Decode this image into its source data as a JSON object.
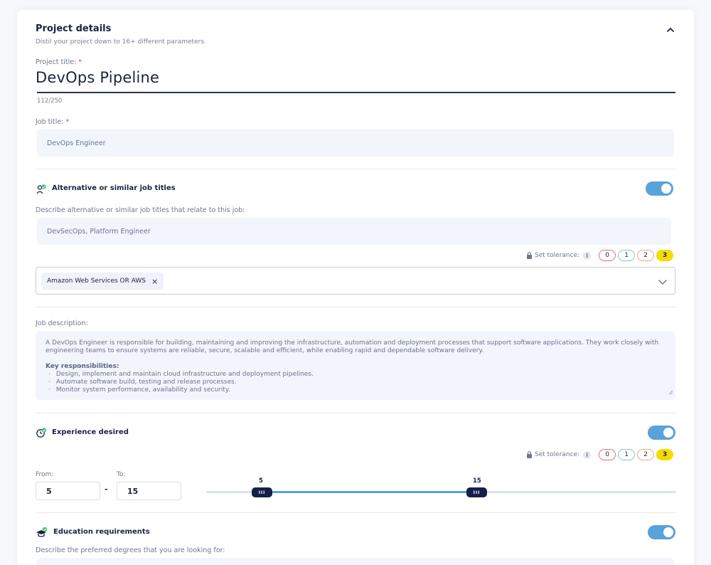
{
  "header": {
    "title": "Project details",
    "subtitle": "Distil your project down to 16+ different parameters."
  },
  "project_title": {
    "label": "Project title:",
    "required": "*",
    "value": "DevOps Pipeline",
    "counter": "112/250"
  },
  "job_title": {
    "label": "Job title:",
    "required": "*",
    "value": "DevOps Engineer"
  },
  "alt_titles": {
    "title": "Alternative or similar job titles",
    "enabled": true,
    "prompt": "Describe alternative or similar job titles that relate to this job:",
    "value": "DevSecOps, Platform Engineer",
    "tolerance_label": "Set tolerance:",
    "tolerance_options": [
      "0",
      "1",
      "2",
      "3"
    ],
    "tolerance_selected": "3",
    "chip": "Amazon Web Services OR AWS",
    "chip_remove": "×"
  },
  "job_description": {
    "label": "Job description:",
    "paragraph": "A DevOps Engineer is responsible for building, maintaining and improving the infrastructure, automation and deployment processes that support software applications. They work closely with engineering teams to ensure systems are reliable, secure, scalable and efficient, while enabling rapid and dependable software delivery.",
    "responsibilities_heading": "Key responsibilities:",
    "responsibilities": [
      "Design, implement and maintain cloud infrastructure and deployment pipelines.",
      "Automate software build, testing and release processes.",
      "Monitor system performance, availability and security."
    ]
  },
  "experience": {
    "title": "Experience desired",
    "enabled": true,
    "tolerance_label": "Set tolerance:",
    "tolerance_options": [
      "0",
      "1",
      "2",
      "3"
    ],
    "tolerance_selected": "3",
    "from_label": "From:",
    "to_label": "To:",
    "from_value": "5",
    "to_value": "15",
    "separator": "-",
    "slider_min": 0,
    "slider_max": 40
  },
  "education": {
    "title": "Education requirements",
    "enabled": true,
    "prompt": "Describe the preferred degrees that you are looking for:"
  },
  "colors": {
    "accent": "#5aa2da",
    "navy": "#15204a",
    "tol0": "#e36b7f",
    "tol1": "#7fc7c2",
    "tol2": "#efa77a",
    "tol3": "#f5dc00"
  },
  "info_glyph": "i"
}
